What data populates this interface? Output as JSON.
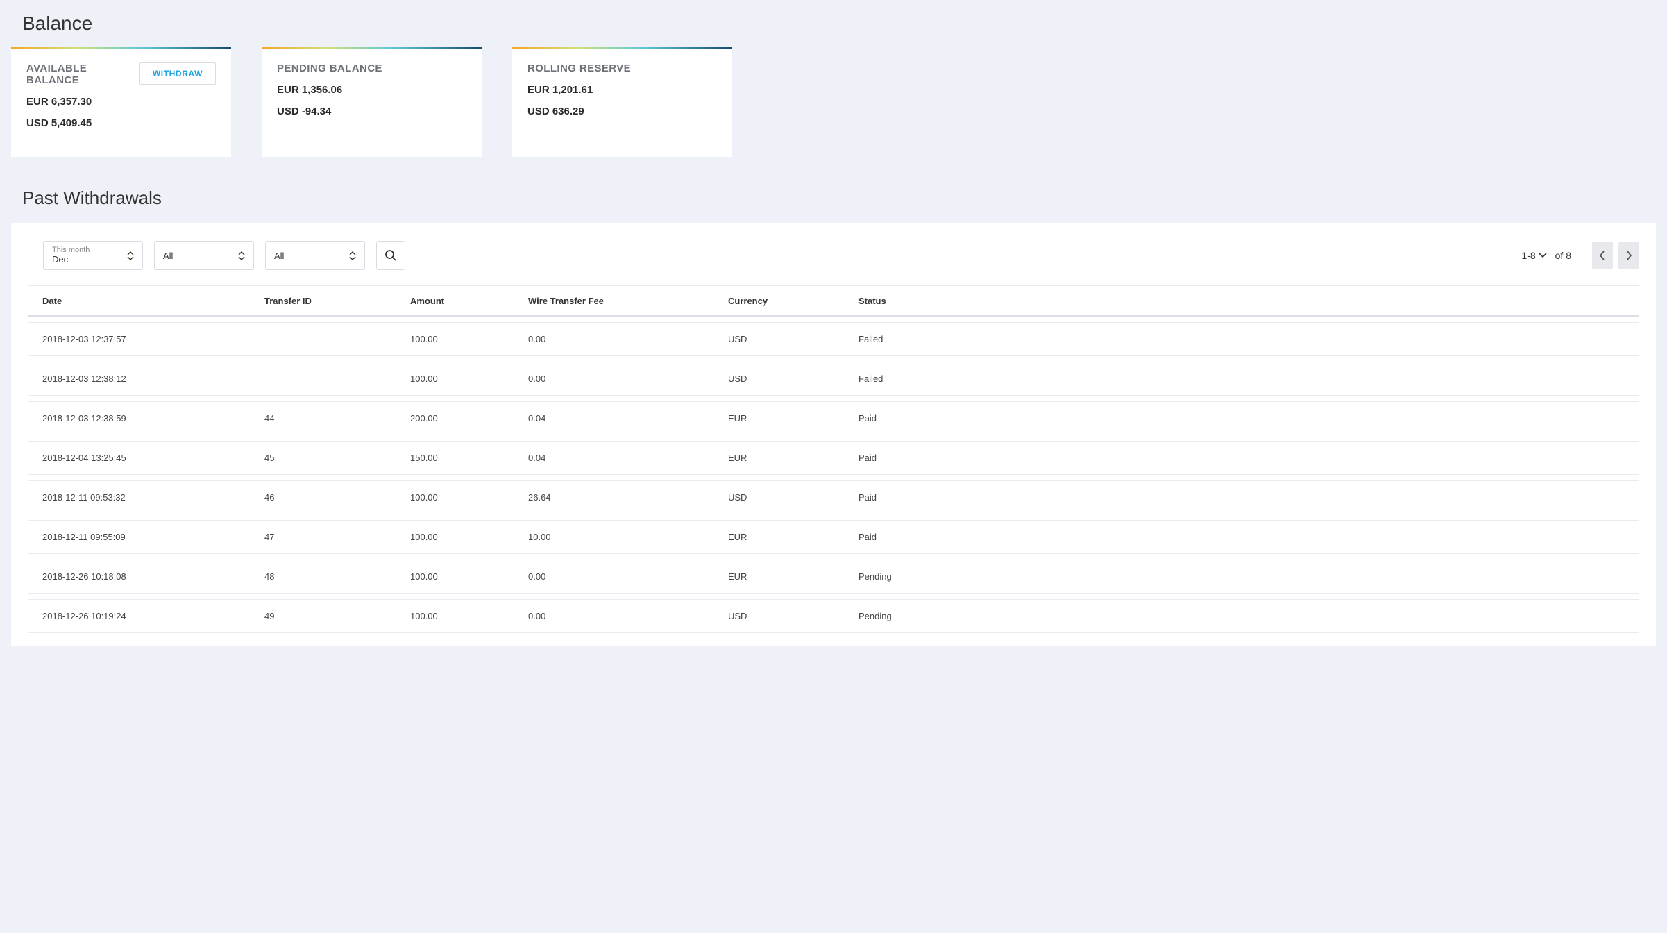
{
  "titles": {
    "balance": "Balance",
    "past_withdrawals": "Past Withdrawals"
  },
  "cards": {
    "available": {
      "title": "AVAILABLE BALANCE",
      "withdraw_label": "WITHDRAW",
      "line1": "EUR 6,357.30",
      "line2": "USD 5,409.45"
    },
    "pending": {
      "title": "PENDING BALANCE",
      "line1": "EUR 1,356.06",
      "line2": "USD -94.34"
    },
    "rolling": {
      "title": "ROLLING RESERVE",
      "line1": "EUR 1,201.61",
      "line2": "USD 636.29"
    }
  },
  "filters": {
    "period_sub": "This month",
    "period_val": "Dec",
    "filter2": "All",
    "filter3": "All"
  },
  "pager": {
    "range": "1-8",
    "of": "of 8"
  },
  "table": {
    "headers": {
      "date": "Date",
      "transfer_id": "Transfer ID",
      "amount": "Amount",
      "fee": "Wire Transfer Fee",
      "currency": "Currency",
      "status": "Status"
    },
    "rows": [
      {
        "date": "2018-12-03 12:37:57",
        "tid": "",
        "amount": "100.00",
        "fee": "0.00",
        "currency": "USD",
        "status": "Failed"
      },
      {
        "date": "2018-12-03 12:38:12",
        "tid": "",
        "amount": "100.00",
        "fee": "0.00",
        "currency": "USD",
        "status": "Failed"
      },
      {
        "date": "2018-12-03 12:38:59",
        "tid": "44",
        "amount": "200.00",
        "fee": "0.04",
        "currency": "EUR",
        "status": "Paid"
      },
      {
        "date": "2018-12-04 13:25:45",
        "tid": "45",
        "amount": "150.00",
        "fee": "0.04",
        "currency": "EUR",
        "status": "Paid"
      },
      {
        "date": "2018-12-11 09:53:32",
        "tid": "46",
        "amount": "100.00",
        "fee": "26.64",
        "currency": "USD",
        "status": "Paid"
      },
      {
        "date": "2018-12-11 09:55:09",
        "tid": "47",
        "amount": "100.00",
        "fee": "10.00",
        "currency": "EUR",
        "status": "Paid"
      },
      {
        "date": "2018-12-26 10:18:08",
        "tid": "48",
        "amount": "100.00",
        "fee": "0.00",
        "currency": "EUR",
        "status": "Pending"
      },
      {
        "date": "2018-12-26 10:19:24",
        "tid": "49",
        "amount": "100.00",
        "fee": "0.00",
        "currency": "USD",
        "status": "Pending"
      }
    ]
  }
}
